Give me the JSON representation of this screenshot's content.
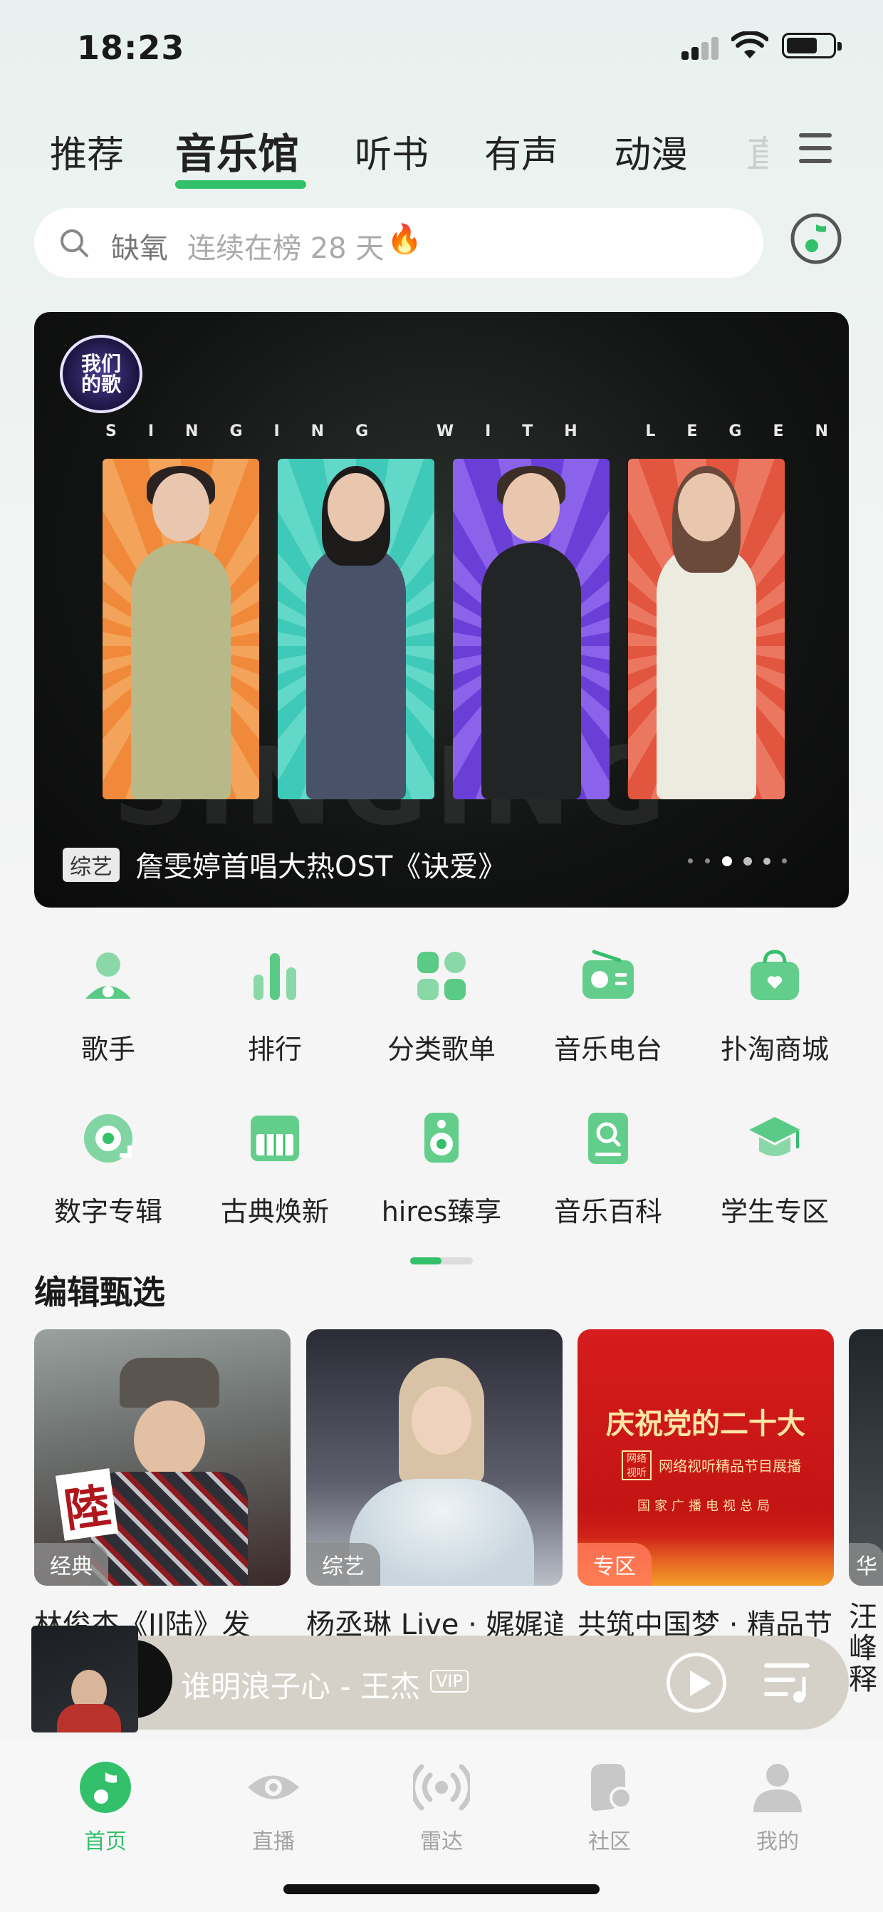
{
  "status_bar": {
    "time": "18:23"
  },
  "top_tabs": [
    {
      "label": "推荐",
      "active": false
    },
    {
      "label": "音乐馆",
      "active": true
    },
    {
      "label": "听书",
      "active": false
    },
    {
      "label": "有声",
      "active": false
    },
    {
      "label": "动漫",
      "active": false
    },
    {
      "label": "直",
      "active": false
    }
  ],
  "search": {
    "query": "缺氧",
    "hint": "连续在榜 28 天",
    "hint_icon": "fire-icon"
  },
  "banner": {
    "slogan": "SINGING WITH LEGENDS",
    "logo_text": "我们的歌",
    "badge": "综艺",
    "caption": "詹雯婷首唱大热OST《诀爱》",
    "watermark": "SINGING",
    "pages": 6,
    "current_page": 3
  },
  "categories": [
    {
      "label": "歌手",
      "icon": "singer-icon"
    },
    {
      "label": "排行",
      "icon": "chart-icon"
    },
    {
      "label": "分类歌单",
      "icon": "category-icon"
    },
    {
      "label": "音乐电台",
      "icon": "radio-icon"
    },
    {
      "label": "扑淘商城",
      "icon": "shop-icon"
    },
    {
      "label": "数字专辑",
      "icon": "digital-album-icon"
    },
    {
      "label": "古典焕新",
      "icon": "piano-icon"
    },
    {
      "label": "hires臻享",
      "icon": "speaker-icon"
    },
    {
      "label": "音乐百科",
      "icon": "encyclopedia-icon"
    },
    {
      "label": "学生专区",
      "icon": "graduation-icon"
    }
  ],
  "accent_color": "#33c06a",
  "editor_picks": {
    "title": "编辑甄选",
    "cards": [
      {
        "tag": "经典",
        "title": "林俊杰《JJ陆》发"
      },
      {
        "tag": "综艺",
        "title": "杨丞琳 Live · 娓娓道"
      },
      {
        "tag": "专区",
        "title": "共筑中国梦 · 精品节",
        "cover_title": "庆祝党的二十大",
        "cover_subtitle": "网络视听精品节目展播",
        "cover_org": "国家广播电视总局",
        "seal": "网络视听"
      },
      {
        "tag": "华",
        "title": "汪峰释"
      }
    ]
  },
  "player": {
    "song": "谁明浪子心 - 王杰",
    "badge": "VIP"
  },
  "bottom_nav": [
    {
      "label": "首页",
      "icon": "home-music-icon",
      "active": true
    },
    {
      "label": "直播",
      "icon": "eye-icon",
      "active": false
    },
    {
      "label": "雷达",
      "icon": "radar-icon",
      "active": false
    },
    {
      "label": "社区",
      "icon": "community-icon",
      "active": false
    },
    {
      "label": "我的",
      "icon": "profile-icon",
      "active": false
    }
  ]
}
